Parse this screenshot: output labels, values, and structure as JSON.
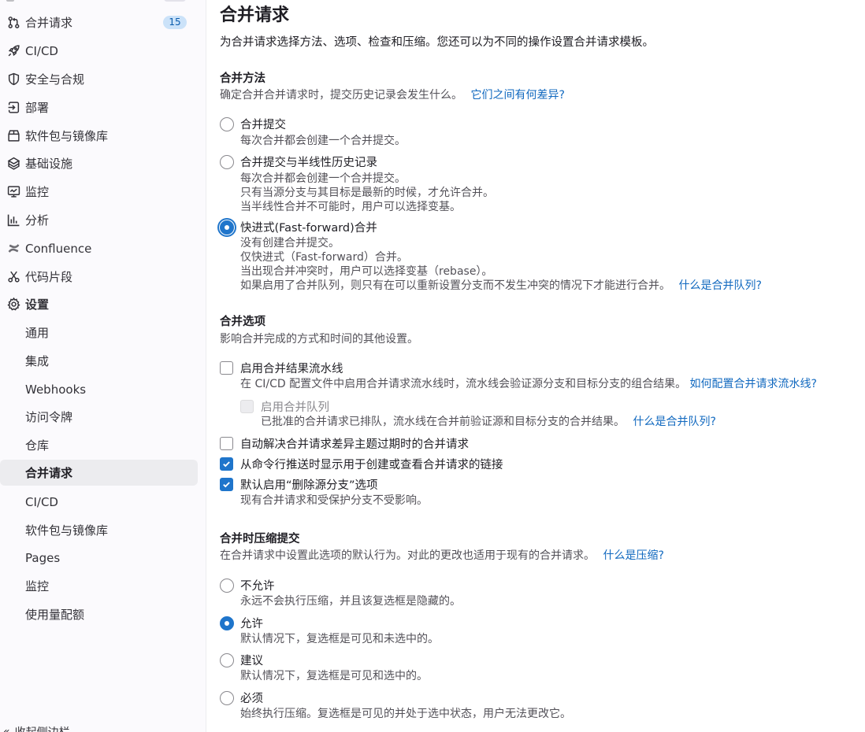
{
  "sidebar": {
    "items": [
      {
        "icon": "merge-request-icon",
        "label": "合并请求",
        "badge": "15"
      },
      {
        "icon": "rocket-icon",
        "label": "CI/CD"
      },
      {
        "icon": "shield-icon",
        "label": "安全与合规"
      },
      {
        "icon": "deployments-icon",
        "label": "部署"
      },
      {
        "icon": "package-icon",
        "label": "软件包与镜像库"
      },
      {
        "icon": "infrastructure-icon",
        "label": "基础设施"
      },
      {
        "icon": "monitor-icon",
        "label": "监控"
      },
      {
        "icon": "chart-icon",
        "label": "分析"
      },
      {
        "icon": "confluence-icon",
        "label": "Confluence"
      },
      {
        "icon": "snippet-icon",
        "label": "代码片段"
      },
      {
        "icon": "gear-icon",
        "label": "设置"
      }
    ],
    "settings_sub": [
      {
        "label": "通用"
      },
      {
        "label": "集成"
      },
      {
        "label": "Webhooks"
      },
      {
        "label": "访问令牌"
      },
      {
        "label": "仓库"
      },
      {
        "label": "合并请求",
        "active": true
      },
      {
        "label": "CI/CD"
      },
      {
        "label": "软件包与镜像库"
      },
      {
        "label": "Pages"
      },
      {
        "label": "监控"
      },
      {
        "label": "使用量配额"
      }
    ],
    "collapse_label": "收起侧边栏"
  },
  "main": {
    "title": "合并请求",
    "description": "为合并请求选择方法、选项、检查和压缩。您还可以为不同的操作设置合并请求模板。",
    "merge_method": {
      "heading": "合并方法",
      "subtitle": "确定合并合并请求时，提交历史记录会发生什么。",
      "link": "它们之间有何差异?",
      "options": [
        {
          "label": "合并提交",
          "help": [
            "每次合并都会创建一个合并提交。"
          ],
          "selected": false
        },
        {
          "label": "合并提交与半线性历史记录",
          "help": [
            "每次合并都会创建一个合并提交。",
            "只有当源分支与其目标是最新的时候，才允许合并。",
            "当半线性合并不可能时，用户可以选择变基。"
          ],
          "selected": false
        },
        {
          "label": "快进式(Fast-forward)合并",
          "help": [
            "没有创建合并提交。",
            "仅快进式（Fast-forward）合并。",
            "当出现合并冲突时，用户可以选择变基（rebase）。",
            "如果启用了合并队列，则只有在可以重新设置分支而不发生冲突的情况下才能进行合并。"
          ],
          "help_link": "什么是合并队列?",
          "selected": true
        }
      ]
    },
    "merge_options": {
      "heading": "合并选项",
      "subtitle": "影响合并完成的方式和时间的其他设置。",
      "options": [
        {
          "label": "启用合并结果流水线",
          "checked": false,
          "help": "在 CI/CD 配置文件中启用合并请求流水线时，流水线会验证源分支和目标分支的组合结果。",
          "help_link": "如何配置合并请求流水线?"
        },
        {
          "label": "启用合并队列",
          "checked": false,
          "disabled": true,
          "help": "已批准的合并请求已排队，流水线在合并前验证源和目标分支的合并结果。",
          "help_link": "什么是合并队列?"
        },
        {
          "label": "自动解决合并请求差异主题过期时的合并请求",
          "checked": false
        },
        {
          "label": "从命令行推送时显示用于创建或查看合并请求的链接",
          "checked": true
        },
        {
          "label": "默认启用“删除源分支”选项",
          "checked": true,
          "help": "现有合并请求和受保护分支不受影响。"
        }
      ]
    },
    "squash": {
      "heading": "合并时压缩提交",
      "subtitle": "在合并请求中设置此选项的默认行为。对此的更改也适用于现有的合并请求。",
      "link": "什么是压缩?",
      "options": [
        {
          "label": "不允许",
          "help": "永远不会执行压缩，并且该复选框是隐藏的。",
          "selected": false
        },
        {
          "label": "允许",
          "help": "默认情况下，复选框是可见和未选中的。",
          "selected": true
        },
        {
          "label": "建议",
          "help": "默认情况下，复选框是可见和选中的。",
          "selected": false
        },
        {
          "label": "必须",
          "help": "始终执行压缩。复选框是可见的并处于选中状态，用户无法更改它。",
          "selected": false
        }
      ]
    }
  }
}
